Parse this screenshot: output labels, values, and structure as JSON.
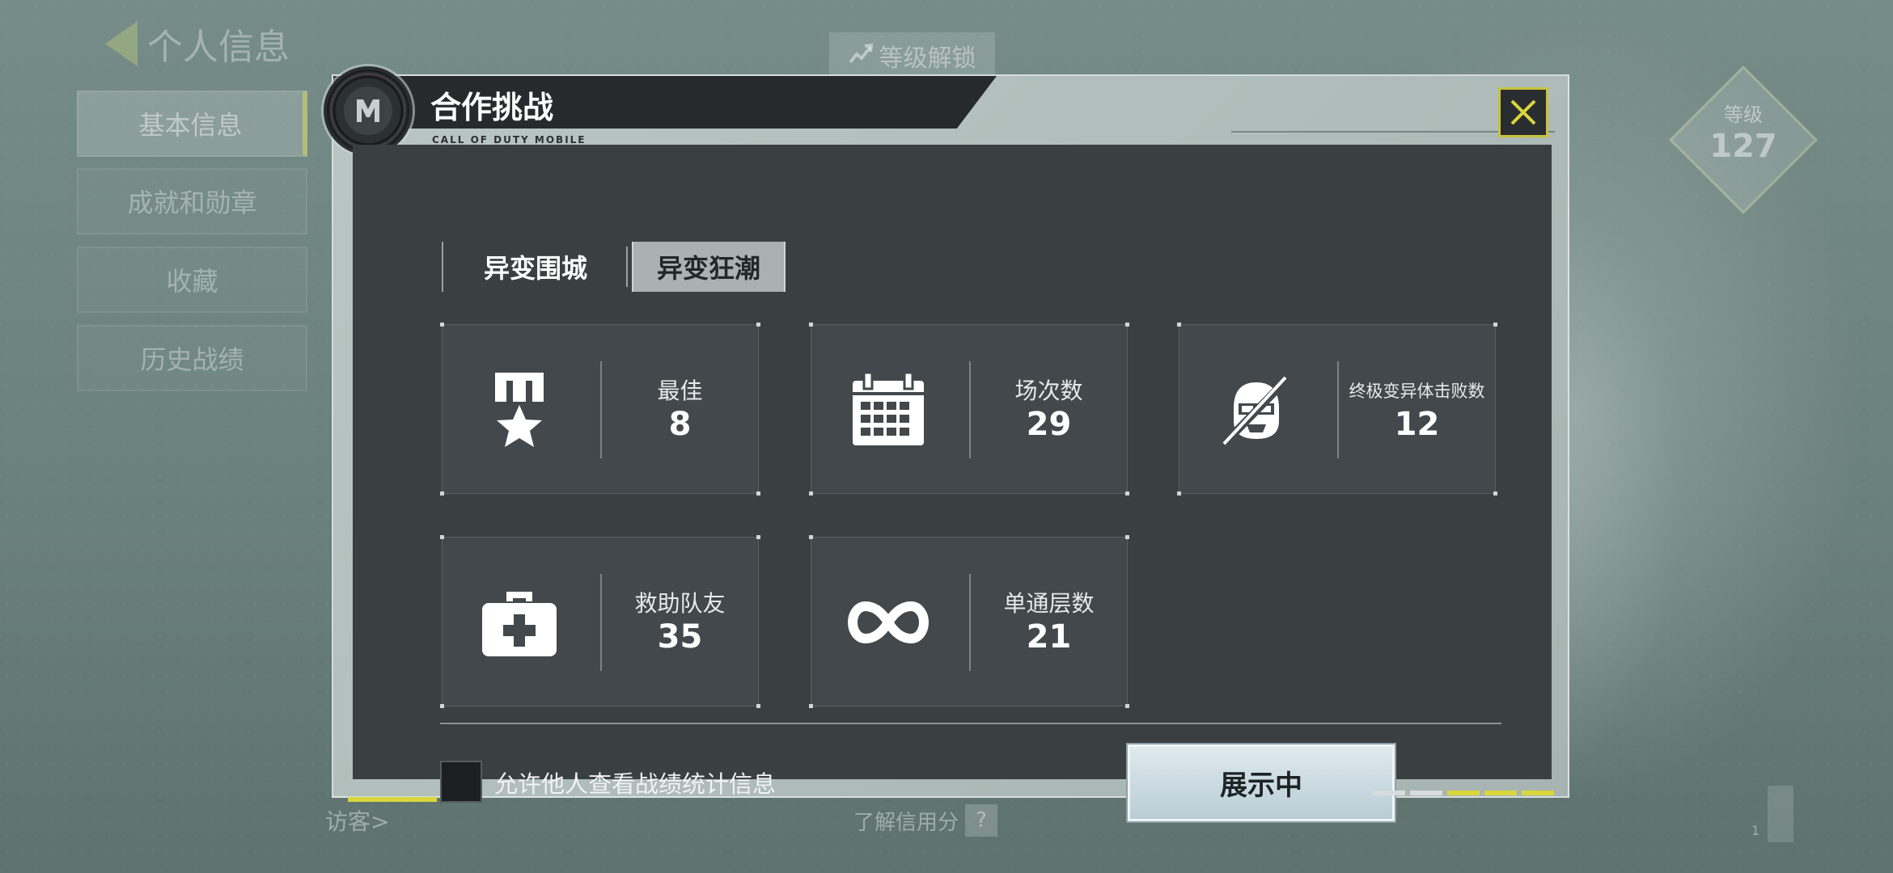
{
  "background": {
    "page_title": "个人信息",
    "sidebar": [
      "基本信息",
      "成就和勋章",
      "收藏",
      "历史战绩"
    ],
    "level_unlock": "等级解锁",
    "level_label": "等级",
    "level_value": "127",
    "visitor_label": "访客>",
    "credit_label": "了解信用分",
    "credit_help": "?",
    "scroll_value": "1"
  },
  "modal": {
    "title": "合作挑战",
    "subtitle": "CALL OF DUTY MOBILE",
    "close_icon": "close-icon",
    "tabs": [
      {
        "label": "异变围城",
        "active": false
      },
      {
        "label": "异变狂潮",
        "active": true
      }
    ],
    "stats": [
      {
        "icon": "medal-star-icon",
        "label": "最佳",
        "value": "8"
      },
      {
        "icon": "calendar-icon",
        "label": "场次数",
        "value": "29"
      },
      {
        "icon": "zombie-kill-icon",
        "label": "终极变异体击败数",
        "value": "12"
      },
      {
        "icon": "medkit-icon",
        "label": "救助队友",
        "value": "35"
      },
      {
        "icon": "infinity-icon",
        "label": "单通层数",
        "value": "21"
      }
    ],
    "allow_others_label": "允许他人查看战绩统计信息",
    "allow_others_checked": false,
    "display_button": "展示中"
  },
  "colors": {
    "accent_yellow": "#d9d63d",
    "panel_bg": "#3a3f42",
    "card_bg": "#42484b"
  }
}
